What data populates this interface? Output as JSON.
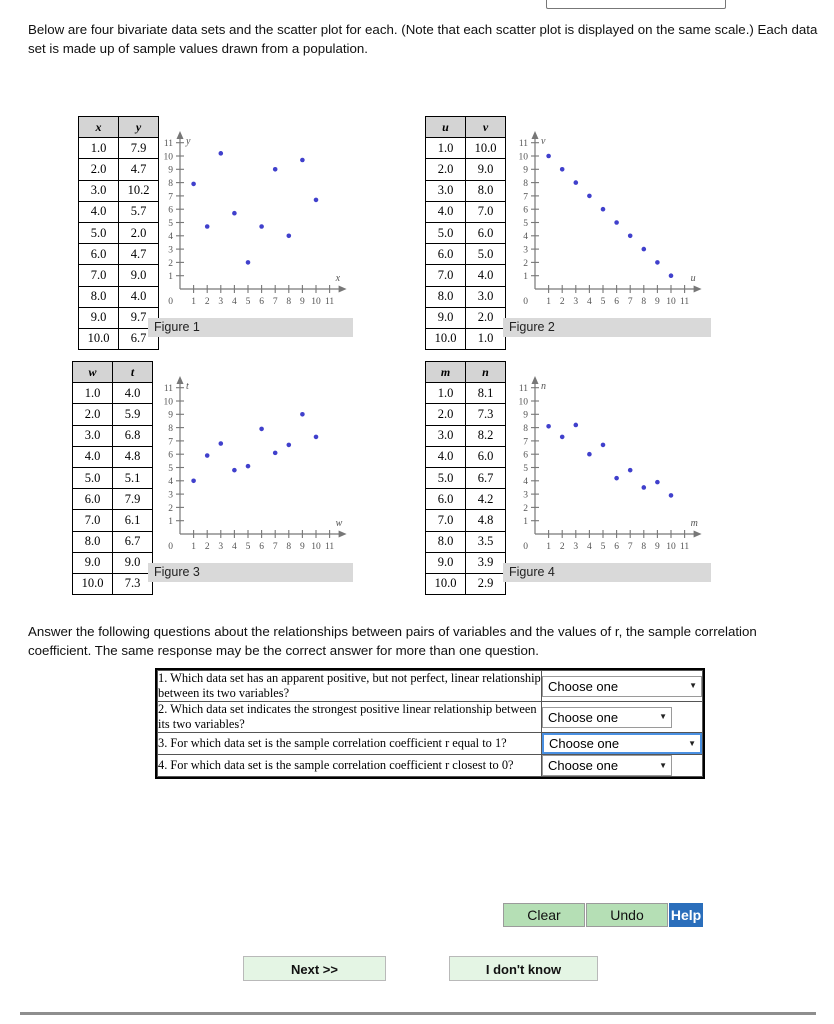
{
  "intro": "Below are four bivariate data sets and the scatter plot for each. (Note that each scatter plot is displayed on the same scale.) Each data set is made up of sample values drawn from a population.",
  "questions_intro": "Answer the following questions about the relationships between pairs of variables and the values of r, the sample correlation coefficient. The same response may be the correct answer for more than one question.",
  "datasets": [
    {
      "id": "dataset-1",
      "figure_label": "Figure 1",
      "x_header": "x",
      "y_header": "y",
      "x_values": [
        "1.0",
        "2.0",
        "3.0",
        "4.0",
        "5.0",
        "6.0",
        "7.0",
        "8.0",
        "9.0",
        "10.0"
      ],
      "y_values": [
        "7.9",
        "4.7",
        "10.2",
        "5.7",
        "2.0",
        "4.7",
        "9.0",
        "4.0",
        "9.7",
        "6.7"
      ]
    },
    {
      "id": "dataset-2",
      "figure_label": "Figure 2",
      "x_header": "u",
      "y_header": "v",
      "x_values": [
        "1.0",
        "2.0",
        "3.0",
        "4.0",
        "5.0",
        "6.0",
        "7.0",
        "8.0",
        "9.0",
        "10.0"
      ],
      "y_values": [
        "10.0",
        "9.0",
        "8.0",
        "7.0",
        "6.0",
        "5.0",
        "4.0",
        "3.0",
        "2.0",
        "1.0"
      ]
    },
    {
      "id": "dataset-3",
      "figure_label": "Figure 3",
      "x_header": "w",
      "y_header": "t",
      "x_values": [
        "1.0",
        "2.0",
        "3.0",
        "4.0",
        "5.0",
        "6.0",
        "7.0",
        "8.0",
        "9.0",
        "10.0"
      ],
      "y_values": [
        "4.0",
        "5.9",
        "6.8",
        "4.8",
        "5.1",
        "7.9",
        "6.1",
        "6.7",
        "9.0",
        "7.3"
      ]
    },
    {
      "id": "dataset-4",
      "figure_label": "Figure 4",
      "x_header": "m",
      "y_header": "n",
      "x_values": [
        "1.0",
        "2.0",
        "3.0",
        "4.0",
        "5.0",
        "6.0",
        "7.0",
        "8.0",
        "9.0",
        "10.0"
      ],
      "y_values": [
        "8.1",
        "7.3",
        "8.2",
        "6.0",
        "6.7",
        "4.2",
        "4.8",
        "3.5",
        "3.9",
        "2.9"
      ]
    }
  ],
  "chart_data": [
    {
      "type": "scatter",
      "title": "Figure 1",
      "xlabel": "x",
      "ylabel": "y",
      "xlim": [
        0,
        11
      ],
      "ylim": [
        0,
        11
      ],
      "xticks": [
        1,
        2,
        3,
        4,
        5,
        6,
        7,
        8,
        9,
        10,
        11
      ],
      "yticks": [
        1,
        2,
        3,
        4,
        5,
        6,
        7,
        8,
        9,
        10,
        11
      ],
      "grid": false,
      "point_color": "#4040cc",
      "x": [
        1,
        2,
        3,
        4,
        5,
        6,
        7,
        8,
        9,
        10
      ],
      "y": [
        7.9,
        4.7,
        10.2,
        5.7,
        2.0,
        4.7,
        9.0,
        4.0,
        9.7,
        6.7
      ]
    },
    {
      "type": "scatter",
      "title": "Figure 2",
      "xlabel": "u",
      "ylabel": "v",
      "xlim": [
        0,
        11
      ],
      "ylim": [
        0,
        11
      ],
      "xticks": [
        1,
        2,
        3,
        4,
        5,
        6,
        7,
        8,
        9,
        10,
        11
      ],
      "yticks": [
        1,
        2,
        3,
        4,
        5,
        6,
        7,
        8,
        9,
        10,
        11
      ],
      "grid": false,
      "point_color": "#4040cc",
      "x": [
        1,
        2,
        3,
        4,
        5,
        6,
        7,
        8,
        9,
        10
      ],
      "y": [
        10.0,
        9.0,
        8.0,
        7.0,
        6.0,
        5.0,
        4.0,
        3.0,
        2.0,
        1.0
      ]
    },
    {
      "type": "scatter",
      "title": "Figure 3",
      "xlabel": "w",
      "ylabel": "t",
      "xlim": [
        0,
        11
      ],
      "ylim": [
        0,
        11
      ],
      "xticks": [
        1,
        2,
        3,
        4,
        5,
        6,
        7,
        8,
        9,
        10,
        11
      ],
      "yticks": [
        1,
        2,
        3,
        4,
        5,
        6,
        7,
        8,
        9,
        10,
        11
      ],
      "grid": false,
      "point_color": "#4040cc",
      "x": [
        1,
        2,
        3,
        4,
        5,
        6,
        7,
        8,
        9,
        10
      ],
      "y": [
        4.0,
        5.9,
        6.8,
        4.8,
        5.1,
        7.9,
        6.1,
        6.7,
        9.0,
        7.3
      ]
    },
    {
      "type": "scatter",
      "title": "Figure 4",
      "xlabel": "m",
      "ylabel": "n",
      "xlim": [
        0,
        11
      ],
      "ylim": [
        0,
        11
      ],
      "xticks": [
        1,
        2,
        3,
        4,
        5,
        6,
        7,
        8,
        9,
        10,
        11
      ],
      "yticks": [
        1,
        2,
        3,
        4,
        5,
        6,
        7,
        8,
        9,
        10,
        11
      ],
      "grid": false,
      "point_color": "#4040cc",
      "x": [
        1,
        2,
        3,
        4,
        5,
        6,
        7,
        8,
        9,
        10
      ],
      "y": [
        8.1,
        7.3,
        8.2,
        6.0,
        6.7,
        4.2,
        4.8,
        3.5,
        3.9,
        2.9
      ]
    }
  ],
  "questions": [
    {
      "number": "1.",
      "text": "1. Which data set has an apparent positive, but not perfect, linear relationship between its two variables?",
      "select_value": "Choose one",
      "focused": false,
      "width": "w160"
    },
    {
      "number": "2.",
      "text": "2. Which data set indicates the strongest positive linear relationship between its two variables?",
      "select_value": "Choose one",
      "focused": false,
      "width": "w130"
    },
    {
      "number": "3.",
      "text": "3. For which data set is the sample correlation coefficient r equal to 1?",
      "select_value": "Choose one",
      "focused": true,
      "width": "w160"
    },
    {
      "number": "4.",
      "text": "4. For which data set is the sample correlation coefficient r closest to 0?",
      "select_value": "Choose one",
      "focused": false,
      "width": "w130"
    }
  ],
  "buttons": {
    "clear": "Clear",
    "undo": "Undo",
    "help": "Help",
    "next": "Next >>",
    "idk": "I don't know"
  },
  "colors": {
    "point": "#4040cc",
    "button_green": "#b5dfb5",
    "help_blue": "#2a6ebb",
    "lower_button_green": "#e4f5e4",
    "focus_blue": "#4a90e2"
  }
}
